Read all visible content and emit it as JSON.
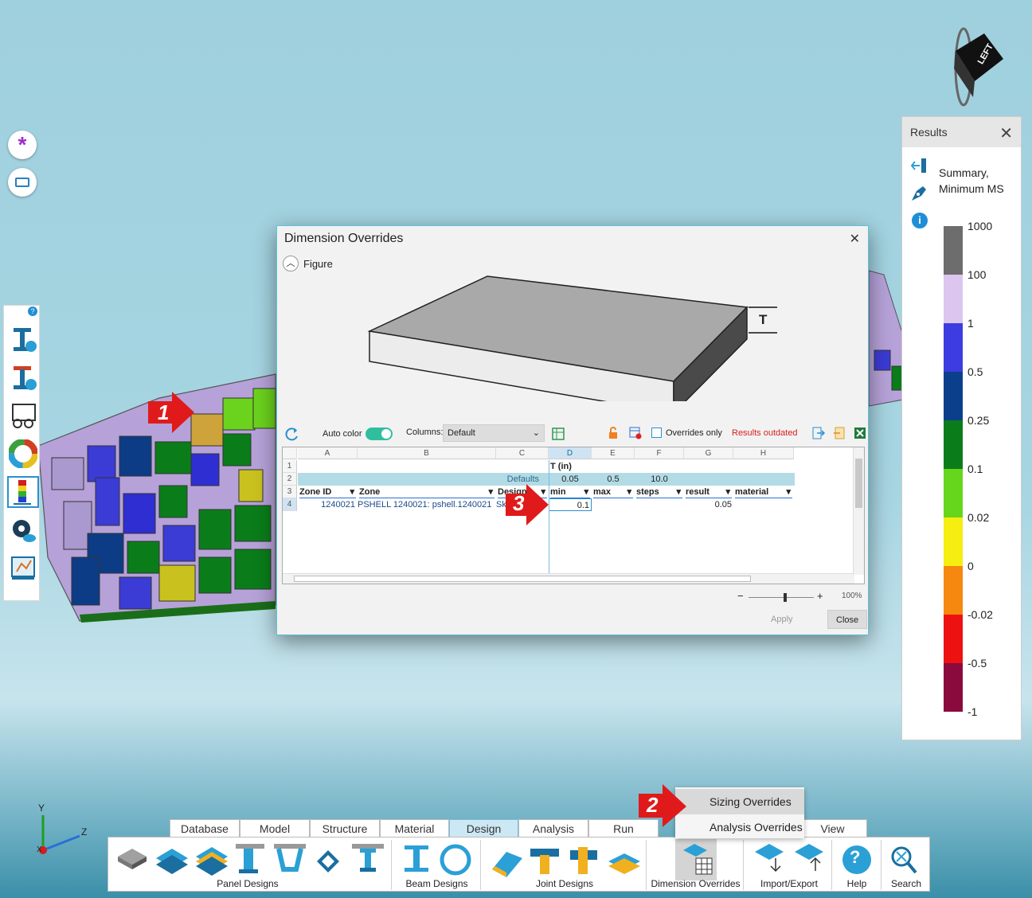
{
  "results": {
    "title": "Results",
    "summary_label": "Summary, Minimum MS",
    "legend": [
      {
        "label": "1000",
        "color": "#6d6d6d"
      },
      {
        "label": "100",
        "color": "#dcc5ef"
      },
      {
        "label": "1",
        "color": "#3c3ce0"
      },
      {
        "label": "0.5",
        "color": "#0b3f8c"
      },
      {
        "label": "0.25",
        "color": "#0a7d1a"
      },
      {
        "label": "0.1",
        "color": "#66d61c"
      },
      {
        "label": "0.02",
        "color": "#f5ee10"
      },
      {
        "label": "0",
        "color": "#f6870f"
      },
      {
        "label": "-0.02",
        "color": "#ee1111"
      },
      {
        "label": "-0.5",
        "color": "#8a0a3e"
      },
      {
        "label": "-1",
        "color": ""
      }
    ]
  },
  "dialog": {
    "title": "Dimension Overrides",
    "figure_label": "Figure",
    "dimension_symbol": "T",
    "toolbar": {
      "auto_color_label": "Auto color",
      "columns_label": "Columns:",
      "columns_value": "Default",
      "overrides_only_label": "Overrides only",
      "results_outdated": "Results outdated"
    },
    "grid": {
      "col_letters": [
        "A",
        "B",
        "C",
        "D",
        "E",
        "F",
        "G",
        "H"
      ],
      "row_numbers": [
        "1",
        "2",
        "3",
        "4"
      ],
      "group_header": "T (in)",
      "defaults_label": "Defaults",
      "defaults": [
        "0.05",
        "0.5",
        "10.0"
      ],
      "headers": [
        "Zone ID",
        "Zone",
        "Design",
        "min",
        "max",
        "steps",
        "result",
        "material"
      ],
      "row": {
        "zone_id": "1240021",
        "zone": "PSHELL 1240021: pshell.1240021",
        "design": "Sk",
        "min": "0.1",
        "result": "0.05"
      }
    },
    "zoom": "100%",
    "apply_label": "Apply",
    "close_label": "Close"
  },
  "ribbon": {
    "tabs": [
      "Database",
      "Model",
      "Structure",
      "Material",
      "Design",
      "Analysis",
      "Run",
      "View"
    ],
    "active_tab": "Design",
    "groups": [
      "Panel Designs",
      "Beam Designs",
      "Joint Designs",
      "Dimension Overrides",
      "Import/Export",
      "Help",
      "Search"
    ]
  },
  "menu": {
    "items": [
      "Sizing Overrides",
      "Analysis Overrides"
    ]
  },
  "callouts": [
    "1",
    "2",
    "3"
  ],
  "axes": {
    "y": "Y",
    "z": "Z",
    "x": "X"
  },
  "view_cube_label": "LEFT",
  "left_toolbar_help": "?"
}
